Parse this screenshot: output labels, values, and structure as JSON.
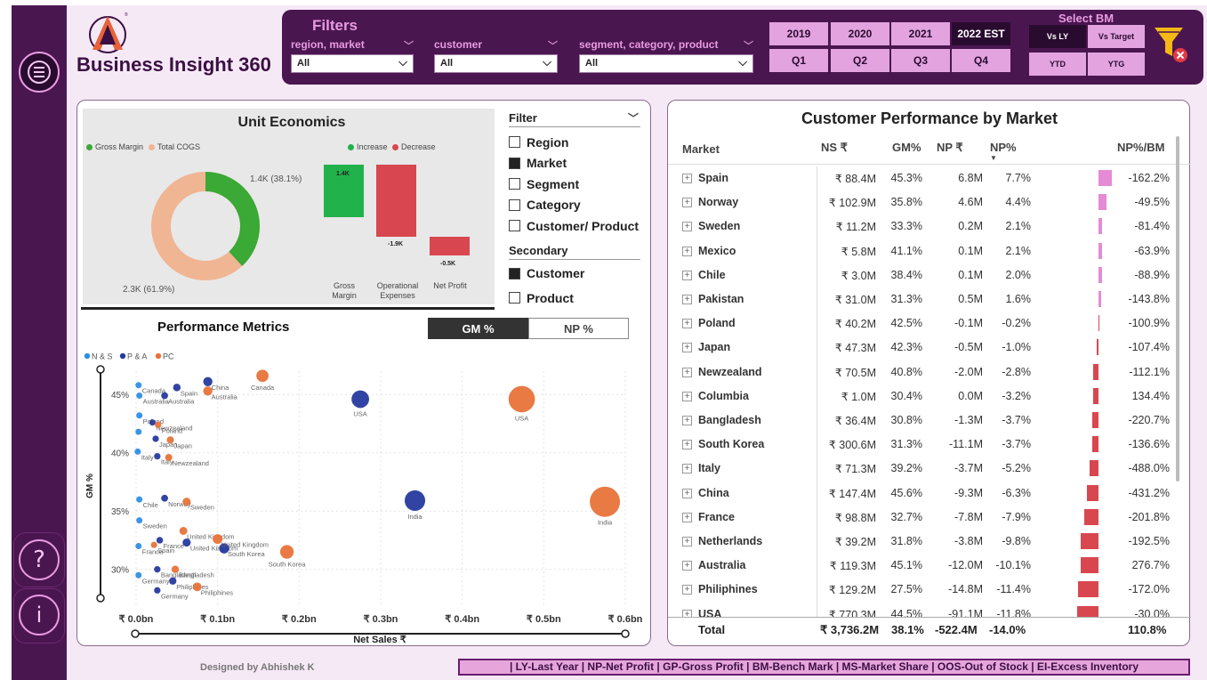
{
  "brand": {
    "title": "Business Insight 360"
  },
  "filters": {
    "title": "Filters",
    "groups": [
      {
        "label": "region, market",
        "value": "All"
      },
      {
        "label": "customer",
        "value": "All"
      },
      {
        "label": "segment, category, product",
        "value": "All"
      }
    ]
  },
  "periods": {
    "years": [
      "2019",
      "2020",
      "2021",
      "2022 EST"
    ],
    "quarters": [
      "Q1",
      "Q2",
      "Q3",
      "Q4"
    ]
  },
  "benchmark": {
    "title": "Select BM",
    "options": [
      "Vs LY",
      "Vs Target",
      "YTD",
      "YTG"
    ]
  },
  "unit_economics": {
    "title": "Unit Economics",
    "donut_legend": [
      "Gross Margin",
      "Total COGS"
    ],
    "donut_gm_label": "1.4K (38.1%)",
    "donut_cogs_label": "2.3K (61.9%)",
    "waterfall_legend": [
      "Increase",
      "Decrease"
    ],
    "waterfall_values": [
      "1.4K",
      "-1.9K",
      "-0.5K"
    ],
    "waterfall_categories": [
      "Gross Margin",
      "Operational Expenses",
      "Net Profit"
    ],
    "colors": {
      "gm": "#3aa935",
      "cogs": "#f0b593",
      "increase": "#22b24c",
      "decrease": "#d8474f"
    }
  },
  "slicer": {
    "filter_title": "Filter",
    "filter_items": [
      {
        "label": "Region",
        "checked": false
      },
      {
        "label": "Market",
        "checked": true
      },
      {
        "label": "Segment",
        "checked": false
      },
      {
        "label": "Category",
        "checked": false
      },
      {
        "label": "Customer/ Product",
        "checked": false
      }
    ],
    "secondary_title": "Secondary",
    "secondary_items": [
      {
        "label": "Customer",
        "checked": true
      },
      {
        "label": "Product",
        "checked": false
      }
    ]
  },
  "performance": {
    "title": "Performance Metrics",
    "toggles": [
      "GM %",
      "NP %"
    ]
  },
  "chart_data": {
    "type": "scatter",
    "xlabel": "Net Sales ₹",
    "ylabel": "GM %",
    "x_ticks": [
      "₹ 0.0bn",
      "₹ 0.1bn",
      "₹ 0.2bn",
      "₹ 0.3bn",
      "₹ 0.4bn",
      "₹ 0.5bn",
      "₹ 0.6bn"
    ],
    "y_ticks": [
      "30%",
      "35%",
      "40%",
      "45%"
    ],
    "xlim": [
      0,
      0.6
    ],
    "ylim": [
      27,
      47
    ],
    "legend": [
      "N & S",
      "P & A",
      "PC"
    ],
    "series": [
      {
        "name": "N & S",
        "color": "#2f8fe6",
        "points": [
          {
            "x": 0.003,
            "y": 45.8,
            "label": "Canada"
          },
          {
            "x": 0.004,
            "y": 44.9,
            "label": "Australia"
          },
          {
            "x": 0.004,
            "y": 43.2,
            "label": "Poland"
          },
          {
            "x": 0.003,
            "y": 41.8,
            "label": ""
          },
          {
            "x": 0.002,
            "y": 40.1,
            "label": "Italy"
          },
          {
            "x": 0.004,
            "y": 36.0,
            "label": "Chile"
          },
          {
            "x": 0.004,
            "y": 34.2,
            "label": "Sweden"
          },
          {
            "x": 0.003,
            "y": 32.0,
            "label": "France"
          },
          {
            "x": 0.003,
            "y": 29.5,
            "label": "Germany"
          }
        ]
      },
      {
        "name": "P & A",
        "color": "#273a9e",
        "points": [
          {
            "x": 0.05,
            "y": 45.6,
            "label": "Spain"
          },
          {
            "x": 0.088,
            "y": 46.1,
            "label": "China"
          },
          {
            "x": 0.035,
            "y": 44.9,
            "label": "Australia"
          },
          {
            "x": 0.02,
            "y": 42.6,
            "label": "Newzealand"
          },
          {
            "x": 0.024,
            "y": 41.2,
            "label": "Japan"
          },
          {
            "x": 0.026,
            "y": 39.7,
            "label": "Italy"
          },
          {
            "x": 0.035,
            "y": 36.1,
            "label": "Norway"
          },
          {
            "x": 0.029,
            "y": 32.5,
            "label": "France"
          },
          {
            "x": 0.062,
            "y": 32.3,
            "label": "United Kingdom"
          },
          {
            "x": 0.108,
            "y": 31.8,
            "label": "South Korea"
          },
          {
            "x": 0.026,
            "y": 30.0,
            "label": "Bangladesh"
          },
          {
            "x": 0.045,
            "y": 29.0,
            "label": "Philiphines"
          },
          {
            "x": 0.026,
            "y": 28.2,
            "label": "Germany"
          },
          {
            "x": 0.275,
            "y": 44.6,
            "label": "USA"
          },
          {
            "x": 0.342,
            "y": 35.9,
            "label": "India"
          }
        ]
      },
      {
        "name": "PC",
        "color": "#e8733a",
        "points": [
          {
            "x": 0.155,
            "y": 46.6,
            "label": "Canada"
          },
          {
            "x": 0.088,
            "y": 45.3,
            "label": "Australia"
          },
          {
            "x": 0.027,
            "y": 42.4,
            "label": "Poland"
          },
          {
            "x": 0.042,
            "y": 41.1,
            "label": "Japan"
          },
          {
            "x": 0.04,
            "y": 39.6,
            "label": "Newzealand"
          },
          {
            "x": 0.062,
            "y": 35.8,
            "label": "Sweden"
          },
          {
            "x": 0.058,
            "y": 33.3,
            "label": "United Kingdom"
          },
          {
            "x": 0.1,
            "y": 32.6,
            "label": "United Kingdom"
          },
          {
            "x": 0.022,
            "y": 32.1,
            "label": "Spain"
          },
          {
            "x": 0.185,
            "y": 31.5,
            "label": "South Korea"
          },
          {
            "x": 0.048,
            "y": 30.0,
            "label": "Bangladesh"
          },
          {
            "x": 0.075,
            "y": 28.5,
            "label": "Philiphines"
          },
          {
            "x": 0.473,
            "y": 44.6,
            "label": "USA"
          },
          {
            "x": 0.575,
            "y": 35.8,
            "label": "India"
          }
        ]
      }
    ]
  },
  "customer_performance": {
    "title": "Customer Performance by Market",
    "headers": [
      "Market",
      "NS ₹",
      "GM%",
      "NP ₹",
      "NP%",
      "NP%/BM"
    ],
    "rows": [
      {
        "market": "Spain",
        "ns": "₹ 88.4M",
        "gm": "45.3%",
        "np": "6.8M",
        "npp": "7.7%",
        "bm": "-162.2%",
        "bar": 7.7
      },
      {
        "market": "Norway",
        "ns": "₹ 102.9M",
        "gm": "35.8%",
        "np": "4.6M",
        "npp": "4.4%",
        "bm": "-49.5%",
        "bar": 4.4
      },
      {
        "market": "Sweden",
        "ns": "₹ 11.2M",
        "gm": "33.3%",
        "np": "0.2M",
        "npp": "2.1%",
        "bm": "-81.4%",
        "bar": 2.1
      },
      {
        "market": "Mexico",
        "ns": "₹ 5.8M",
        "gm": "41.1%",
        "np": "0.1M",
        "npp": "2.1%",
        "bm": "-63.9%",
        "bar": 2.1
      },
      {
        "market": "Chile",
        "ns": "₹ 3.0M",
        "gm": "38.4%",
        "np": "0.1M",
        "npp": "2.0%",
        "bm": "-88.9%",
        "bar": 2.0
      },
      {
        "market": "Pakistan",
        "ns": "₹ 31.0M",
        "gm": "31.3%",
        "np": "0.5M",
        "npp": "1.6%",
        "bm": "-143.8%",
        "bar": 1.6
      },
      {
        "market": "Poland",
        "ns": "₹ 40.2M",
        "gm": "42.5%",
        "np": "-0.1M",
        "npp": "-0.2%",
        "bm": "-100.9%",
        "bar": -0.2
      },
      {
        "market": "Japan",
        "ns": "₹ 47.3M",
        "gm": "42.3%",
        "np": "-0.5M",
        "npp": "-1.0%",
        "bm": "-107.4%",
        "bar": -1.0
      },
      {
        "market": "Newzealand",
        "ns": "₹ 70.5M",
        "gm": "40.8%",
        "np": "-2.0M",
        "npp": "-2.8%",
        "bm": "-112.1%",
        "bar": -2.8
      },
      {
        "market": "Columbia",
        "ns": "₹ 1.0M",
        "gm": "30.4%",
        "np": "0.0M",
        "npp": "-3.2%",
        "bm": "134.4%",
        "bar": -3.2
      },
      {
        "market": "Bangladesh",
        "ns": "₹ 36.4M",
        "gm": "30.8%",
        "np": "-1.3M",
        "npp": "-3.7%",
        "bm": "-220.7%",
        "bar": -3.7
      },
      {
        "market": "South Korea",
        "ns": "₹ 300.6M",
        "gm": "31.3%",
        "np": "-11.1M",
        "npp": "-3.7%",
        "bm": "-136.6%",
        "bar": -3.7
      },
      {
        "market": "Italy",
        "ns": "₹ 71.3M",
        "gm": "39.2%",
        "np": "-3.7M",
        "npp": "-5.2%",
        "bm": "-488.0%",
        "bar": -5.2
      },
      {
        "market": "China",
        "ns": "₹ 147.4M",
        "gm": "45.6%",
        "np": "-9.3M",
        "npp": "-6.3%",
        "bm": "-431.2%",
        "bar": -6.3
      },
      {
        "market": "France",
        "ns": "₹ 98.8M",
        "gm": "32.7%",
        "np": "-7.8M",
        "npp": "-7.9%",
        "bm": "-201.8%",
        "bar": -7.9
      },
      {
        "market": "Netherlands",
        "ns": "₹ 39.2M",
        "gm": "31.8%",
        "np": "-3.8M",
        "npp": "-9.8%",
        "bm": "-192.5%",
        "bar": -9.8
      },
      {
        "market": "Australia",
        "ns": "₹ 119.3M",
        "gm": "45.1%",
        "np": "-12.0M",
        "npp": "-10.1%",
        "bm": "276.7%",
        "bar": -10.1
      },
      {
        "market": "Philiphines",
        "ns": "₹ 129.2M",
        "gm": "27.5%",
        "np": "-14.8M",
        "npp": "-11.4%",
        "bm": "-172.0%",
        "bar": -11.4
      },
      {
        "market": "USA",
        "ns": "₹ 770.3M",
        "gm": "44.5%",
        "np": "-91.1M",
        "npp": "-11.8%",
        "bm": "-30.0%",
        "bar": -11.8
      }
    ],
    "total": {
      "label": "Total",
      "ns": "₹ 3,736.2M",
      "gm": "38.1%",
      "np": "-522.4M",
      "npp": "-14.0%",
      "bm": "110.8%"
    },
    "colors": {
      "positive": "#e58bd6",
      "negative": "#d8474f"
    }
  },
  "footer": {
    "designer": "Designed by Abhishek K",
    "glossary": "| LY-Last Year | NP-Net Profit | GP-Gross Profit | BM-Bench Mark | MS-Market Share | OOS-Out of Stock | EI-Excess Inventory"
  }
}
